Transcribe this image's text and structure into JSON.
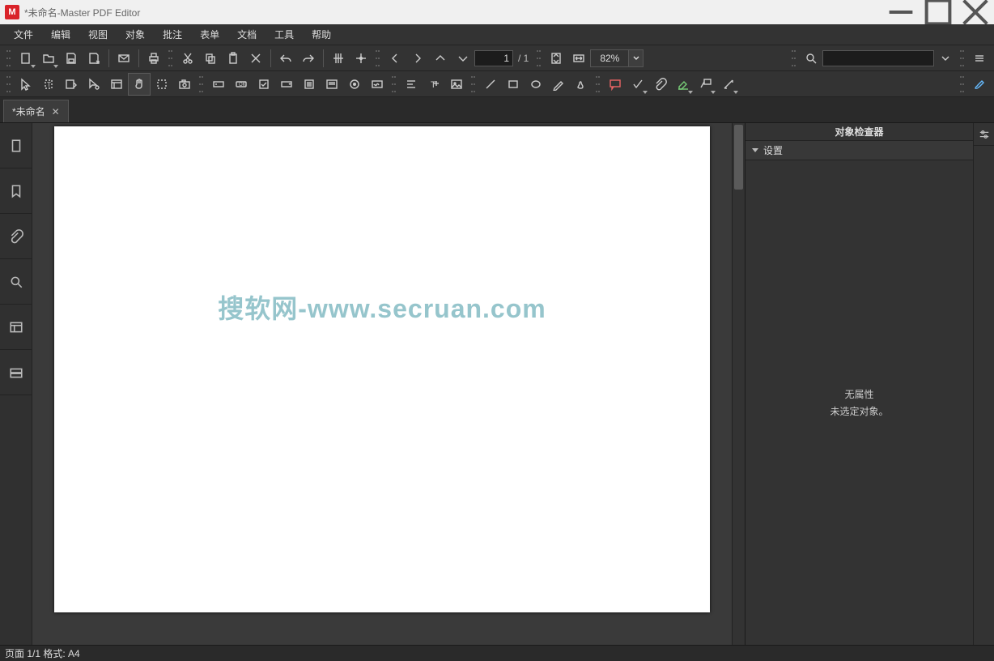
{
  "window": {
    "title": "*未命名-Master PDF Editor",
    "app_initial": "M"
  },
  "menu": [
    "文件",
    "编辑",
    "视图",
    "对象",
    "批注",
    "表单",
    "文档",
    "工具",
    "帮助"
  ],
  "toolbar": {
    "page_current": "1",
    "page_total": "/ 1",
    "zoom": "82%",
    "search_placeholder": ""
  },
  "tabs": [
    {
      "label": "*未命名"
    }
  ],
  "watermark": "搜软网-www.secruan.com",
  "inspector": {
    "title": "对象检查器",
    "section": "设置",
    "empty_line1": "无属性",
    "empty_line2": "未选定对象。"
  },
  "status": {
    "text": "页面 1/1 格式: A4"
  }
}
